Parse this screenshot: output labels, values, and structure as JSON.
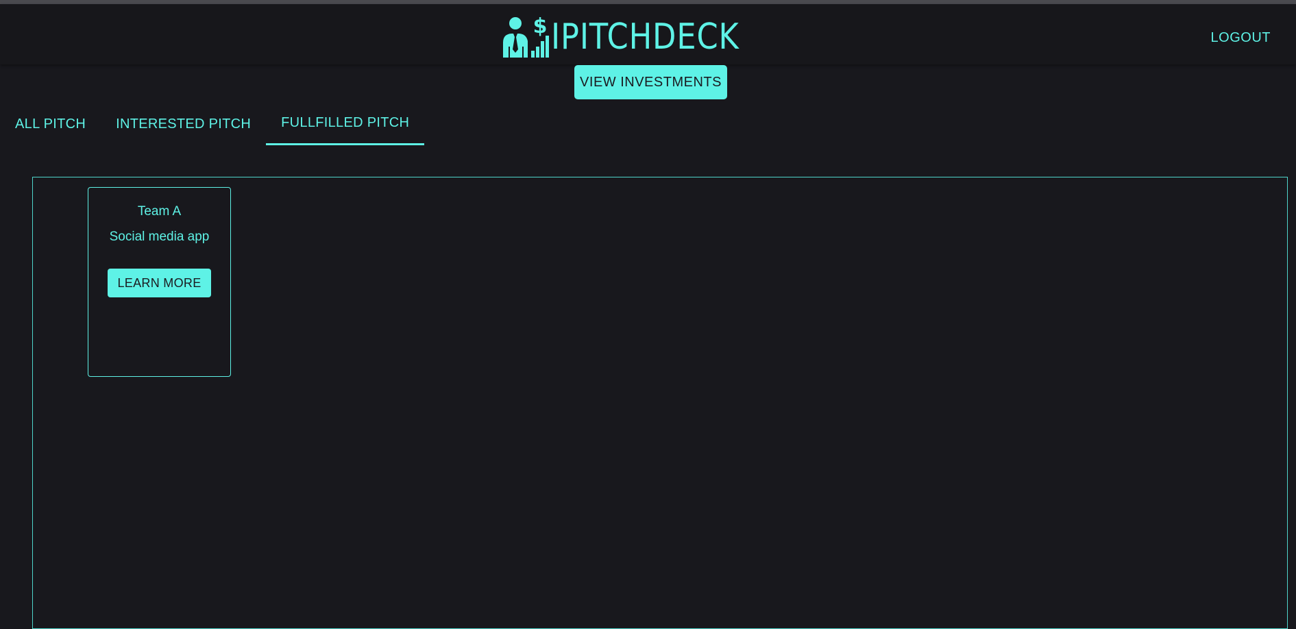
{
  "header": {
    "brand_name": "IPITCHDECK",
    "logout_label": "LOGOUT"
  },
  "actions": {
    "view_investments_label": "VIEW INVESTMENTS"
  },
  "tabs": [
    {
      "label": "ALL PITCH",
      "active": false
    },
    {
      "label": "INTERESTED PITCH",
      "active": false
    },
    {
      "label": "FULLFILLED PITCH",
      "active": true
    }
  ],
  "pitches": [
    {
      "team": "Team A",
      "description": "Social media app",
      "button_label": "LEARN MORE"
    }
  ],
  "icons": {
    "logo": "businessman-dollar-chart-icon"
  },
  "colors": {
    "accent": "#5ef2e6",
    "background": "#18181d",
    "header_background": "#17171b",
    "button_text": "#1b1b20"
  }
}
